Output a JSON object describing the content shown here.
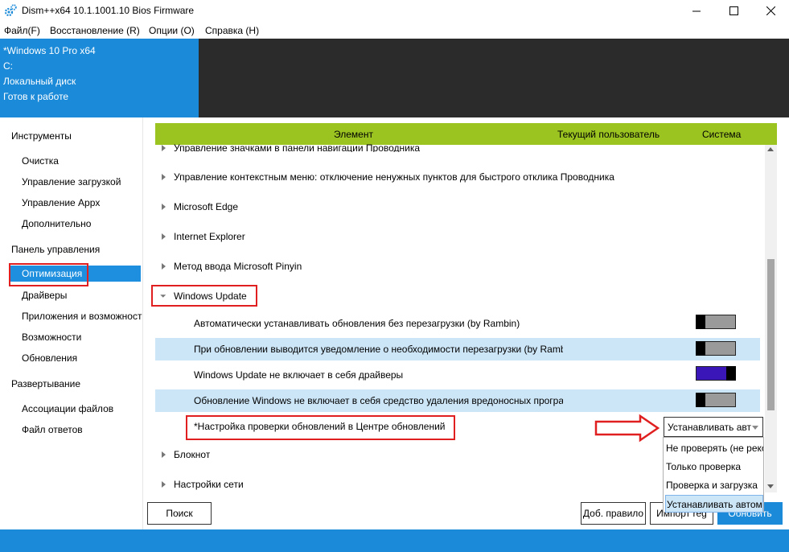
{
  "window": {
    "title": "Dism++x64 10.1.1001.10 Bios Firmware",
    "icon": "gear-icon"
  },
  "menu": [
    "Файл(F)",
    "Восстановление (R)",
    "Опции (O)",
    "Справка (H)"
  ],
  "info": {
    "os": "*Windows 10 Pro x64",
    "drive": "C:",
    "disk_type": "Локальный диск",
    "status": "Готов к работе"
  },
  "sidebar": {
    "tools_header": "Инструменты",
    "tools": [
      "Очистка",
      "Управление загрузкой",
      "Управление Appx",
      "Дополнительно"
    ],
    "control_header": "Панель управления",
    "control": [
      "Оптимизация",
      "Драйверы",
      "Приложения и возможности",
      "Возможности",
      "Обновления"
    ],
    "deploy_header": "Развертывание",
    "deploy": [
      "Ассоциации файлов",
      "Файл ответов"
    ]
  },
  "grid": {
    "columns": [
      "Элемент",
      "Текущий пользователь",
      "Система"
    ],
    "groups": [
      "Управление значками в панели навигации Проводника",
      "Управление контекстным меню: отключение ненужных пунктов для быстрого отклика Проводника",
      "Microsoft Edge",
      "Internet Explorer",
      "Метод ввода Microsoft Pinyin"
    ],
    "expanded_group": "Windows Update",
    "items": [
      "Автоматически устанавливать обновления без перезагрузки (by Rambin)",
      "При обновлении выводится уведомление о необходимости перезагрузки (by Rambin)",
      "Windows Update не включает в себя драйверы",
      "Обновление Windows не включает в себя средство удаления вредоносных программ"
    ],
    "toggles": [
      false,
      false,
      true,
      false
    ],
    "update_check_setting": "*Настройка проверки обновлений в Центре обновлений",
    "more_groups": [
      "Блокнот",
      "Настройки сети"
    ]
  },
  "combo": {
    "value": "Устанавливать автоматически",
    "options": [
      "Не проверять (не рекомендуется)",
      "Только проверка",
      "Проверка и загрузка",
      "Устанавливать автоматически"
    ]
  },
  "buttons": {
    "search": "Поиск",
    "add_rule": "Доб. правило",
    "import": "Импорт reg",
    "refresh": "Обновить"
  },
  "colors": {
    "accent": "#1b8ad8",
    "header_green": "#9bc421",
    "annotation_red": "#e02020",
    "toggle_on": "#3a16b8"
  }
}
